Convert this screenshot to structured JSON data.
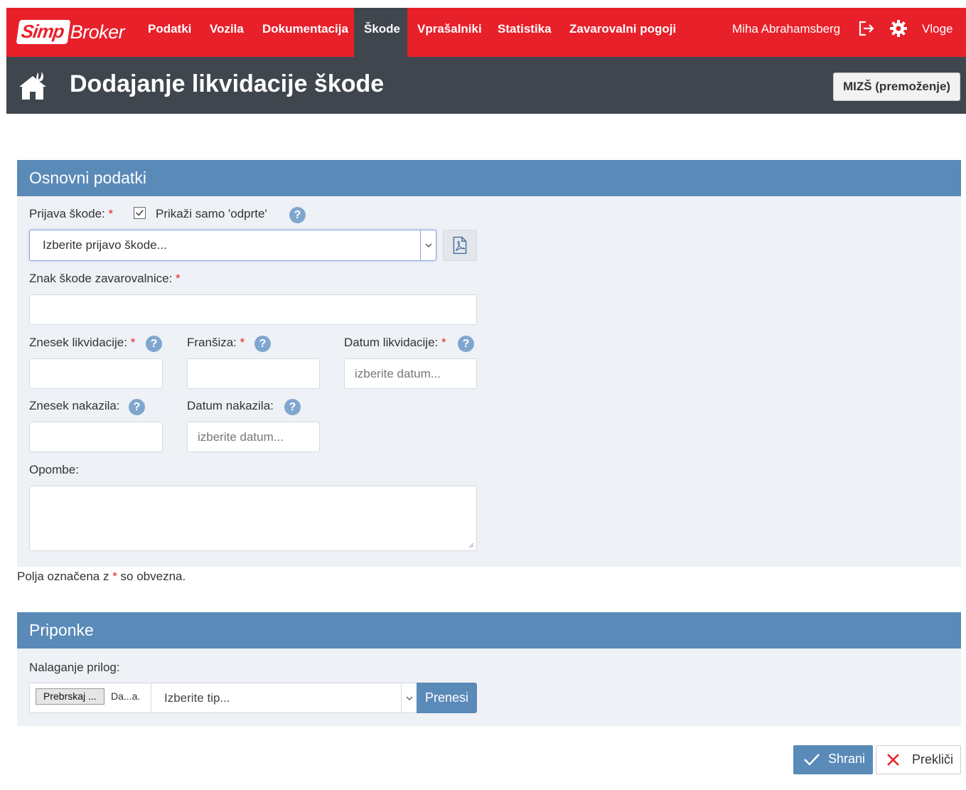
{
  "brand": {
    "logo_left": "Simp",
    "logo_right": "Broker"
  },
  "nav": {
    "items": [
      "Podatki",
      "Vozila",
      "Dokumentacija",
      "Škode",
      "Vprašalniki",
      "Statistika",
      "Zavarovalni pogoji"
    ],
    "active": "Škode",
    "user": "Miha Abrahamsberg",
    "roles": "Vloge",
    "icons": [
      "logout-icon",
      "gear-icon"
    ]
  },
  "header": {
    "title": "Dodajanje likvidacije škode",
    "context_button": "MIZŠ (premoženje)",
    "icon": "house-fire-icon"
  },
  "basic": {
    "title": "Osnovni podatki",
    "claim_label": "Prijava škode:",
    "only_open_label": "Prikaži samo 'odprte'",
    "only_open_checked": true,
    "claim_placeholder": "Izberite prijavo škode...",
    "insurer_mark_label": "Znak škode zavarovalnice:",
    "liquidation_amount_label": "Znesek likvidacije:",
    "deductible_label": "Franšiza:",
    "liquidation_date_label": "Datum likvidacije:",
    "date_placeholder": "izberite datum...",
    "payment_amount_label": "Znesek nakazila:",
    "payment_date_label": "Datum nakazila:",
    "notes_label": "Opombe:",
    "required_mark": "*",
    "help_mark": "?"
  },
  "required_note": {
    "before": "Polja označena z ",
    "star": "*",
    "after": " so obvezna."
  },
  "attachments": {
    "title": "Priponke",
    "upload_label": "Nalaganje prilog:",
    "browse_button": "Prebrskaj ...",
    "file_name": "Da...a.",
    "type_placeholder": "Izberite tip...",
    "upload_button": "Prenesi"
  },
  "footer": {
    "save": "Shrani",
    "cancel": "Prekliči"
  },
  "colors": {
    "brand_red": "#e8202a",
    "dark": "#3f464e",
    "panel_blue": "#5a8ab8",
    "panel_bg": "#eef1f5"
  }
}
